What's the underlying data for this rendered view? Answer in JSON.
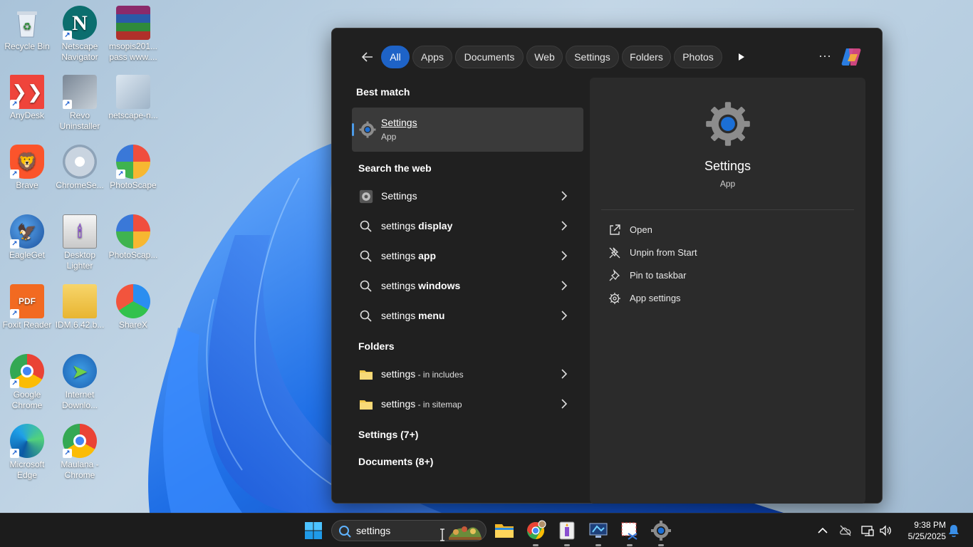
{
  "desktop": {
    "icons": [
      {
        "label": "Recycle Bin"
      },
      {
        "label": "Netscape Navigator"
      },
      {
        "label": "msopis201... pass www...."
      },
      {
        "label": "AnyDesk"
      },
      {
        "label": "Revo Uninstaller"
      },
      {
        "label": "netscape-n..."
      },
      {
        "label": "Brave"
      },
      {
        "label": "ChromeSe..."
      },
      {
        "label": "PhotoScape"
      },
      {
        "label": "EagleGet"
      },
      {
        "label": "Desktop Lighter"
      },
      {
        "label": "PhotoScap..."
      },
      {
        "label": "Foxit Reader"
      },
      {
        "label": "IDM.6.42.b..."
      },
      {
        "label": "ShareX"
      },
      {
        "label": "Google Chrome"
      },
      {
        "label": "Internet Downlo..."
      },
      {
        "label": "Microsoft Edge"
      },
      {
        "label": "Maulana - Chrome"
      }
    ]
  },
  "search_panel": {
    "filters": [
      "All",
      "Apps",
      "Documents",
      "Web",
      "Settings",
      "Folders",
      "Photos"
    ],
    "active_filter": "All",
    "best_match": {
      "heading": "Best match",
      "name": "Settings",
      "type": "App"
    },
    "web": {
      "heading": "Search the web",
      "items": [
        {
          "prefix": "Settings",
          "bold": ""
        },
        {
          "prefix": "settings ",
          "bold": "display"
        },
        {
          "prefix": "settings ",
          "bold": "app"
        },
        {
          "prefix": "settings ",
          "bold": "windows"
        },
        {
          "prefix": "settings ",
          "bold": "menu"
        }
      ]
    },
    "folders": {
      "heading": "Folders",
      "items": [
        {
          "name": "settings",
          "location": " - in includes"
        },
        {
          "name": "settings",
          "location": " - in sitemap"
        }
      ]
    },
    "more_sections": [
      "Settings (7+)",
      "Documents (8+)"
    ],
    "detail": {
      "title": "Settings",
      "type": "App",
      "actions": [
        "Open",
        "Unpin from Start",
        "Pin to taskbar",
        "App settings"
      ]
    }
  },
  "taskbar": {
    "search_value": "settings",
    "clock_time": "9:38 PM",
    "clock_date": "5/25/2025"
  },
  "colors": {
    "accent": "#1e63c7",
    "panel_bg": "#202020",
    "detail_bg": "#2b2b2b",
    "folder_yellow": "#f2c94c"
  }
}
